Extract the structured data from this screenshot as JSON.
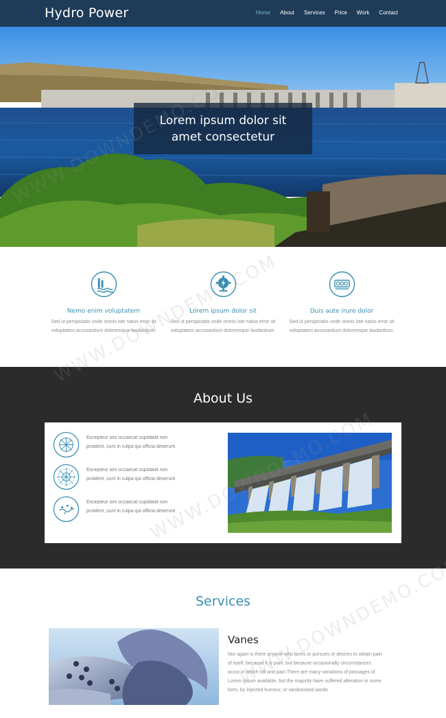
{
  "nav": {
    "brand": "Hydro Power",
    "items": [
      {
        "label": "Home",
        "active": true
      },
      {
        "label": "About"
      },
      {
        "label": "Services"
      },
      {
        "label": "Price"
      },
      {
        "label": "Work"
      },
      {
        "label": "Contact"
      }
    ]
  },
  "hero": {
    "caption": "Lorem ipsum dolor sit amet consectetur"
  },
  "features": [
    {
      "icon": "dam-waves-icon",
      "title": "Nemo enim voluptatem",
      "text": "Sed ut perspiciatis unde omnis iste natus error sit voluptatem accusantium doloremque laudantium."
    },
    {
      "icon": "gear-bolt-icon",
      "title": "Lorem ipsum dolor sit",
      "text": "Sed ut perspiciatis unde omnis iste natus error sit voluptatem accusantium doloremque laudantium."
    },
    {
      "icon": "turbine-icon",
      "title": "Duis aute irure dolor",
      "text": "Sed ut perspiciatis unde omnis iste natus error sit voluptatem accusantium doloremque laudantium."
    }
  ],
  "about": {
    "title": "About Us",
    "items": [
      {
        "icon": "snowflake-wheel-icon",
        "text": "Excepteur sint occaecat cupidatat non proident, sunt in culpa qui officia deserunt."
      },
      {
        "icon": "sun-wheel-icon",
        "text": "Excepteur sint occaecat cupidatat non proident, sunt in culpa qui officia deserunt."
      },
      {
        "icon": "water-drops-icon",
        "text": "Excepteur sint occaecat cupidatat non proident, sunt in culpa qui officia deserunt."
      }
    ]
  },
  "services": {
    "title": "Services",
    "item_title": "Vanes",
    "item_text": "Nor again is there anyone who loves or pursues or desires to obtain pain of itself, because it is pain, but because occasionally circumstances occur in which toil and pain There are many variations of passages of Lorem Ipsum available, but the majority have suffered alteration in some form, by injected humour, or randomised words"
  },
  "watermark": "WWW.DOWNDEMO.COM",
  "colors": {
    "nav_bg": "#1e3b58",
    "accent": "#3a8fb1",
    "about_bg": "#2b2b2b"
  }
}
